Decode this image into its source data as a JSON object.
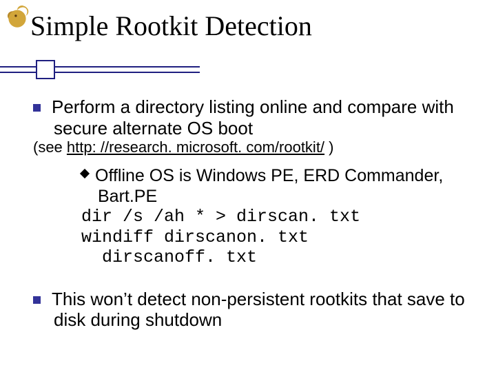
{
  "title": "Simple Rootkit Detection",
  "bullet1": {
    "text": "Perform a directory listing online and compare with secure alternate OS boot",
    "see_prefix": "(see ",
    "see_link": "http: //research. microsoft. com/rootkit/",
    "see_suffix": " )"
  },
  "sub": {
    "line": "Offline OS is Windows PE, ERD Commander, Bart.PE",
    "cmd1": "dir /s /ah * > dirscan. txt",
    "cmd2": "windiff dirscanon. txt\n  dirscanoff. txt"
  },
  "bullet2": "This won’t detect non-persistent rootkits that save to disk during shutdown"
}
